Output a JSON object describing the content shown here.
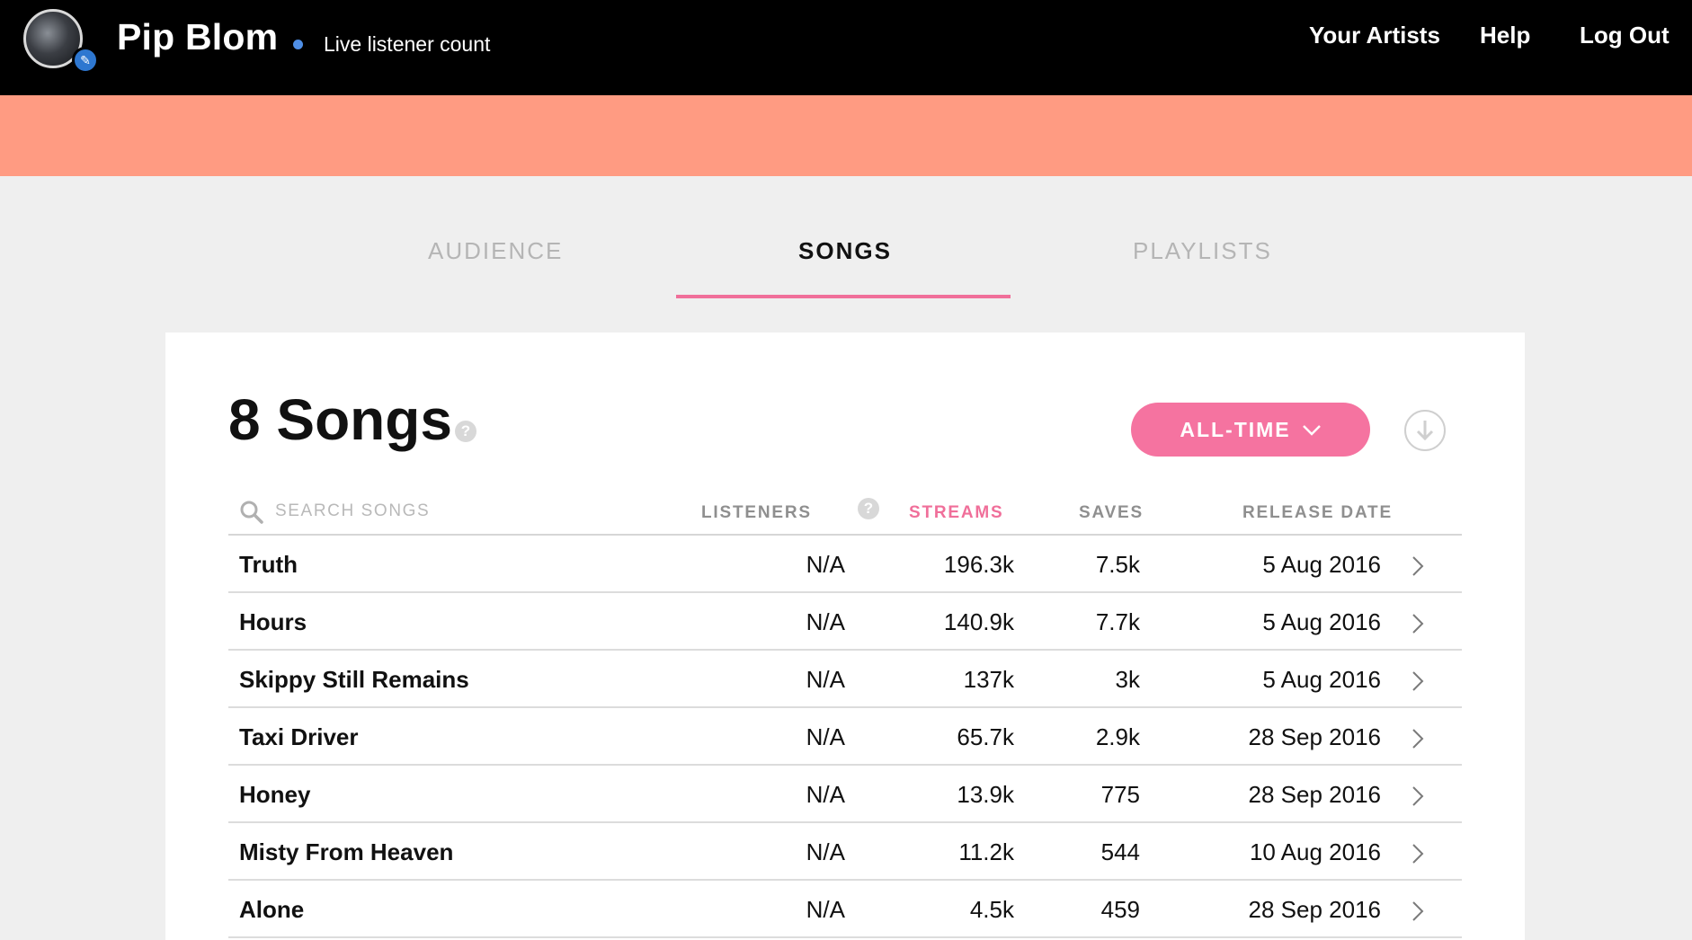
{
  "header": {
    "artist_name": "Pip Blom",
    "live_label": "Live listener count",
    "nav": [
      "Your Artists",
      "Help",
      "Log Out"
    ]
  },
  "tabs": [
    {
      "label": "AUDIENCE",
      "active": false
    },
    {
      "label": "SONGS",
      "active": true
    },
    {
      "label": "PLAYLISTS",
      "active": false
    }
  ],
  "songs_panel": {
    "title": "8 Songs",
    "help_glyph": "?",
    "range_label": "ALL-TIME",
    "search_placeholder": "SEARCH SONGS",
    "columns": {
      "listeners": "LISTENERS",
      "streams": "STREAMS",
      "saves": "SAVES",
      "release_date": "RELEASE DATE"
    },
    "sorted_column": "streams",
    "rows": [
      {
        "name": "Truth",
        "listeners": "N/A",
        "streams": "196.3k",
        "saves": "7.5k",
        "release_date": "5 Aug 2016"
      },
      {
        "name": "Hours",
        "listeners": "N/A",
        "streams": "140.9k",
        "saves": "7.7k",
        "release_date": "5 Aug 2016"
      },
      {
        "name": "Skippy Still Remains",
        "listeners": "N/A",
        "streams": "137k",
        "saves": "3k",
        "release_date": "5 Aug 2016"
      },
      {
        "name": "Taxi Driver",
        "listeners": "N/A",
        "streams": "65.7k",
        "saves": "2.9k",
        "release_date": "28 Sep 2016"
      },
      {
        "name": "Honey",
        "listeners": "N/A",
        "streams": "13.9k",
        "saves": "775",
        "release_date": "28 Sep 2016"
      },
      {
        "name": "Misty From Heaven",
        "listeners": "N/A",
        "streams": "11.2k",
        "saves": "544",
        "release_date": "10 Aug 2016"
      },
      {
        "name": "Alone",
        "listeners": "N/A",
        "streams": "4.5k",
        "saves": "459",
        "release_date": "28 Sep 2016"
      }
    ]
  },
  "colors": {
    "banner": "#ff9b82",
    "accent_pink": "#f573a0",
    "live_dot": "#4f8fe6",
    "verified_badge": "#2e77d0"
  },
  "icons": {
    "avatar_badge": "pencil-icon",
    "range_dropdown": "chevron-down-icon",
    "download": "download-icon",
    "search": "search-icon",
    "row": "chevron-right-icon"
  }
}
